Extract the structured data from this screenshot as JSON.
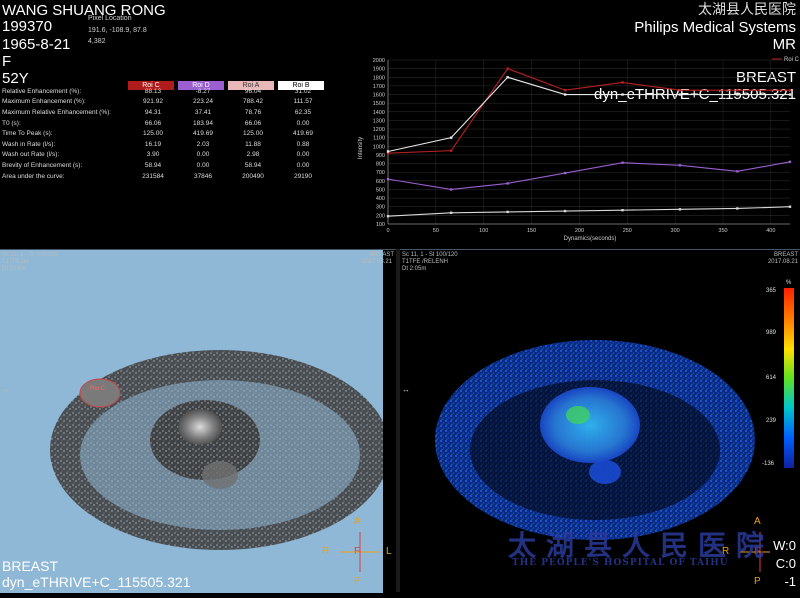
{
  "patient": {
    "name": "WANG SHUANG RONG",
    "id": "199370",
    "dob": "1965-8-21",
    "sex": "F",
    "age": "52Y"
  },
  "hospital_cn": "太湖县人民医院",
  "vendor": "Philips Medical Systems",
  "modality": "MR",
  "body_part": "BREAST",
  "series": "dyn_eTHRIVE+C_115505.321",
  "pixel_location": {
    "label": "Pixel Location",
    "coords": "191.6, -108.9, 87.8",
    "value": "4,382"
  },
  "roi_table": {
    "headers": [
      "Roi C",
      "Roi D",
      "Roi A",
      "Roi B"
    ],
    "header_colors": [
      "#b01c1c",
      "#9a5fd0",
      "#e8b8b8",
      "#ffffff"
    ],
    "header_text_colors": [
      "#ffffff",
      "#ffffff",
      "#333333",
      "#000000"
    ],
    "rows": [
      {
        "label": "Relative Enhancement  (%):",
        "values": [
          "88.13",
          "-8.27",
          "96.04",
          "31.02"
        ]
      },
      {
        "label": "Maximum Enhancement  (%):",
        "values": [
          "921.92",
          "223.24",
          "788.42",
          "111.57"
        ]
      },
      {
        "label": "Maximum Relative Enhancement  (%):",
        "values": [
          "94.31",
          "37.41",
          "78.76",
          "62.35"
        ]
      },
      {
        "label": "T0 (s):",
        "values": [
          "66.06",
          "183.94",
          "66.06",
          "0.00"
        ]
      },
      {
        "label": "Time To Peak  (s):",
        "values": [
          "125.00",
          "419.69",
          "125.00",
          "419.69"
        ]
      },
      {
        "label": "Wash in Rate  (l/s):",
        "values": [
          "16.19",
          "2.03",
          "11.88",
          "0.88"
        ]
      },
      {
        "label": "Wash out Rate  (l/s):",
        "values": [
          "3.90",
          "0.00",
          "2.98",
          "0.00"
        ]
      },
      {
        "label": "Brevity of Enhancement  (s):",
        "values": [
          "58.94",
          "0.00",
          "58.94",
          "0.00"
        ]
      },
      {
        "label": "Area under the curve:",
        "values": [
          "231584",
          "37846",
          "200490",
          "29190"
        ]
      }
    ]
  },
  "chart_data": {
    "type": "line",
    "xlabel": "Dynamics(seconds)",
    "ylabel": "Intensity",
    "xlim": [
      0,
      420
    ],
    "ylim": [
      100,
      2000
    ],
    "xticks": [
      0,
      50,
      100,
      150,
      200,
      250,
      300,
      350,
      400
    ],
    "yticks": [
      100,
      200,
      300,
      400,
      500,
      600,
      700,
      800,
      900,
      1000,
      1100,
      1200,
      1300,
      1400,
      1500,
      1600,
      1700,
      1800,
      1900,
      2000
    ],
    "legend_visible": [
      "Roi C"
    ],
    "series": [
      {
        "name": "Roi C",
        "color": "#b82020",
        "x": [
          0,
          66,
          125,
          185,
          245,
          305,
          365,
          420
        ],
        "y": [
          920,
          950,
          1900,
          1650,
          1740,
          1650,
          1650,
          1650
        ]
      },
      {
        "name": "Roi A",
        "color": "#e8e8e8",
        "x": [
          0,
          66,
          125,
          185,
          245,
          305,
          365,
          420
        ],
        "y": [
          940,
          1100,
          1800,
          1600,
          1600,
          1600,
          1600,
          1600
        ]
      },
      {
        "name": "Roi D",
        "color": "#9a5fd0",
        "x": [
          0,
          66,
          125,
          185,
          245,
          305,
          365,
          420
        ],
        "y": [
          620,
          500,
          570,
          690,
          810,
          780,
          710,
          820
        ]
      },
      {
        "name": "Roi B",
        "color": "#d8d8d8",
        "x": [
          0,
          66,
          125,
          185,
          245,
          305,
          365,
          420
        ],
        "y": [
          190,
          230,
          240,
          250,
          260,
          270,
          280,
          300
        ]
      }
    ]
  },
  "left_view": {
    "series_info": "Sc 11, 1 - Sl 100/120",
    "sequence": "T1TFE  /M",
    "dt": "Dt  2:05m",
    "date": "2017.08.21",
    "body_part": "BREAST",
    "roi_label": "Roi C",
    "bg_color": "#8fb8d6"
  },
  "right_view": {
    "series_info": "Sc 11, 1 - Sl 100/120",
    "sequence": "T1TFE  /RELENH",
    "dt": "Dt  2:05m",
    "date": "2017.08.21",
    "body_part": "BREAST",
    "window": "W:0",
    "center": "C:0",
    "extra": "-1",
    "colorbar": {
      "unit": "%",
      "ticks": [
        "365",
        "989",
        "614",
        "239",
        "-136"
      ]
    }
  },
  "orientation": {
    "a": "A",
    "r": "R",
    "f": "F",
    "l": "L",
    "p": "P"
  },
  "watermark": {
    "text": "太湖县人民医院",
    "sub": "THE PEOPLE'S HOSPITAL OF TAIHU"
  }
}
